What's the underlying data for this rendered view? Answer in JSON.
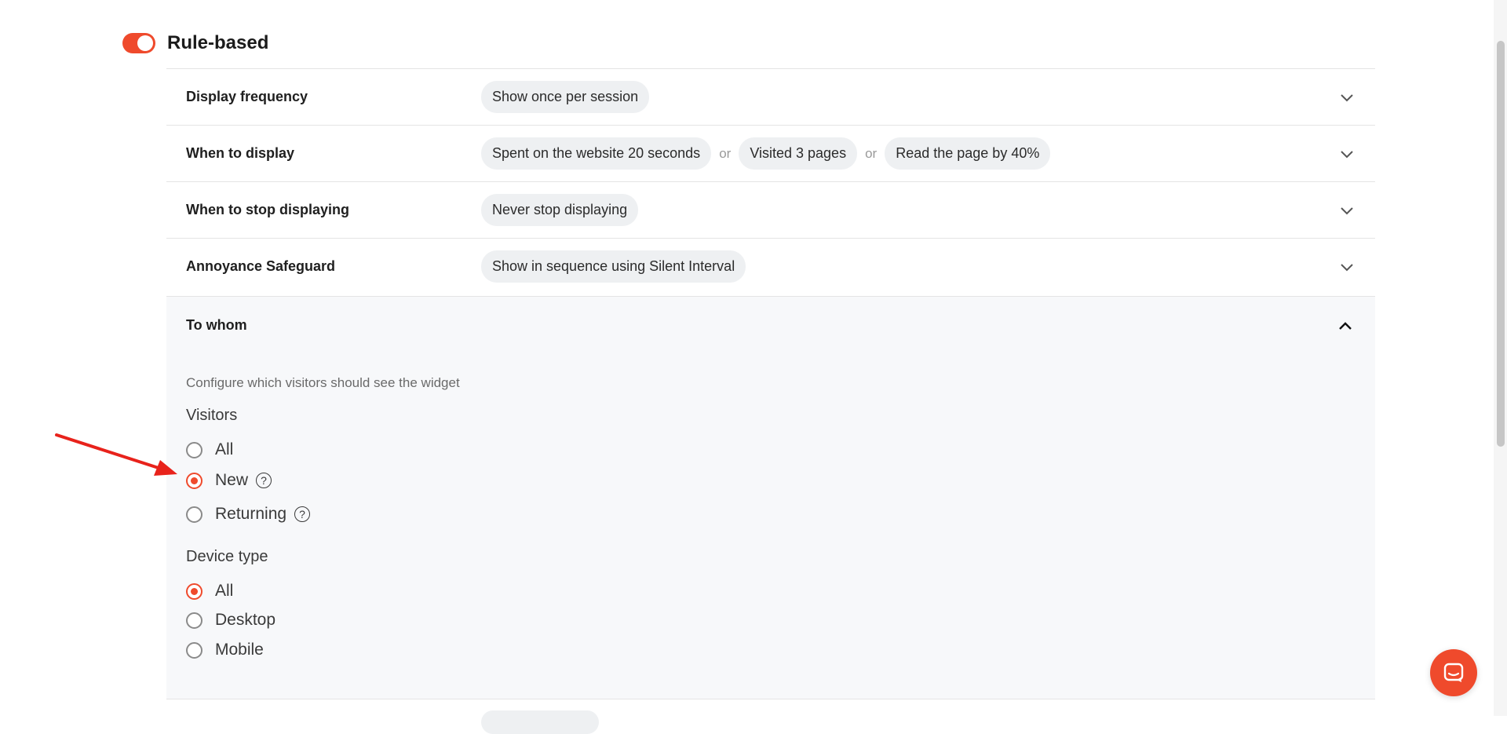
{
  "header": {
    "title": "Rule-based",
    "toggle_on": true
  },
  "rows": [
    {
      "label": "Display frequency",
      "chips": [
        "Show once per session"
      ]
    },
    {
      "label": "When to display",
      "chips": [
        "Spent on the website 20 seconds",
        "Visited 3 pages",
        "Read the page by 40%"
      ],
      "separator": "or"
    },
    {
      "label": "When to stop displaying",
      "chips": [
        "Never stop displaying"
      ]
    },
    {
      "label": "Annoyance Safeguard",
      "chips": [
        "Show in sequence using Silent Interval"
      ]
    }
  ],
  "to_whom": {
    "title": "To whom",
    "description": "Configure which visitors should see the widget",
    "visitors": {
      "title": "Visitors",
      "options": [
        {
          "label": "All",
          "selected": false,
          "help": false
        },
        {
          "label": "New",
          "selected": true,
          "help": true
        },
        {
          "label": "Returning",
          "selected": false,
          "help": true
        }
      ]
    },
    "device_type": {
      "title": "Device type",
      "options": [
        {
          "label": "All",
          "selected": true
        },
        {
          "label": "Desktop",
          "selected": false
        },
        {
          "label": "Mobile",
          "selected": false
        }
      ]
    }
  },
  "help_glyph": "?",
  "colors": {
    "accent": "#ef4a2c",
    "chip_bg": "#eef0f2",
    "annotation_arrow": "#e8221b"
  },
  "icons": {
    "chevron_down": "chevron-down-icon",
    "chevron_up": "chevron-up-icon",
    "help": "question-circle-icon",
    "chat": "chat-icon"
  }
}
